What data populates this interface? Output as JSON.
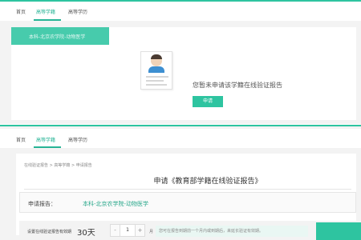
{
  "top": {
    "nav": [
      "首页",
      "高等学籍",
      "高等学历"
    ],
    "active_nav": "高等学籍",
    "watermark_text": "本科-北京农学院-动物医学",
    "message": "您暂未申请该学籍在线验证报告",
    "apply_button": "申请"
  },
  "bottom": {
    "nav": [
      "首页",
      "高等学籍",
      "高等学历"
    ],
    "breadcrumb": "在线验证报告 > 高等学籍 > 申请报告",
    "title": "申请《教育部学籍在线验证报告》",
    "report_label": "申请报告：",
    "report_value": "本科-北京农学院-动物医学",
    "period_label": "设置在线验证报告有效期",
    "period_days": "30天",
    "stepper_value": "1",
    "stepper_minus": "-",
    "stepper_plus": "+",
    "month_unit": "月",
    "hint": "您可在报告到期前一个月内或到期后，来延长验证有效期。"
  },
  "colors": {
    "accent": "#2ec4a0",
    "link_green": "#27b496",
    "background_gray": "#f3f3f3"
  },
  "icons": [
    "document-profile-icon"
  ]
}
